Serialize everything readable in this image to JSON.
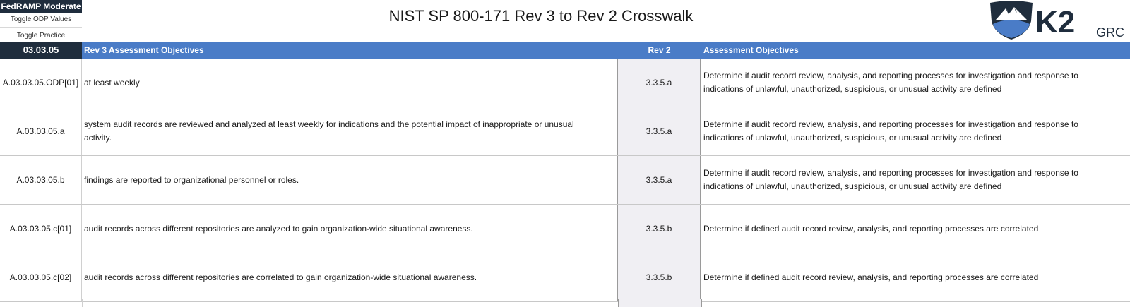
{
  "left_panel": {
    "fedramp_label": "FedRAMP Moderate",
    "toggle_odp_label": "Toggle ODP Values",
    "toggle_practice_label": "Toggle Practice"
  },
  "title": "NIST SP 800-171 Rev 3 to Rev 2 Crosswalk",
  "logo": {
    "k2": "K2",
    "grc": "GRC"
  },
  "colors": {
    "header_blue": "#4a7cc7",
    "navy": "#1f2d3d",
    "rev2_bg": "#f0eff3"
  },
  "header": {
    "control_id": "03.03.05",
    "rev3_objectives": "Rev 3 Assessment Objectives",
    "rev2": "Rev 2",
    "assessment_objectives": "Assessment Objectives"
  },
  "rows": [
    {
      "id": "A.03.03.05.ODP[01]",
      "objective": "at least weekly",
      "rev2": "3.3.5.a",
      "assessment": "Determine if audit record review, analysis, and reporting processes for investigation and response to indications of unlawful, unauthorized, suspicious, or unusual activity are defined"
    },
    {
      "id": "A.03.03.05.a",
      "objective": "system audit records are reviewed and analyzed at least weekly for indications and the potential impact of inappropriate or unusual activity.",
      "rev2": "3.3.5.a",
      "assessment": "Determine if audit record review, analysis, and reporting processes for investigation and response to indications of unlawful, unauthorized, suspicious, or unusual activity are defined"
    },
    {
      "id": "A.03.03.05.b",
      "objective": "findings are reported to organizational personnel or roles.",
      "rev2": "3.3.5.a",
      "assessment": "Determine if audit record review, analysis, and reporting processes for investigation and response to indications of unlawful, unauthorized, suspicious, or unusual activity are defined"
    },
    {
      "id": "A.03.03.05.c[01]",
      "objective": "audit records across different repositories are analyzed to gain organization-wide situational awareness.",
      "rev2": "3.3.5.b",
      "assessment": "Determine if defined audit record review, analysis, and reporting processes are correlated"
    },
    {
      "id": "A.03.03.05.c[02]",
      "objective": "audit records across different repositories are correlated to gain organization-wide situational awareness.",
      "rev2": "3.3.5.b",
      "assessment": "Determine if defined audit record review, analysis, and reporting processes are correlated"
    }
  ]
}
